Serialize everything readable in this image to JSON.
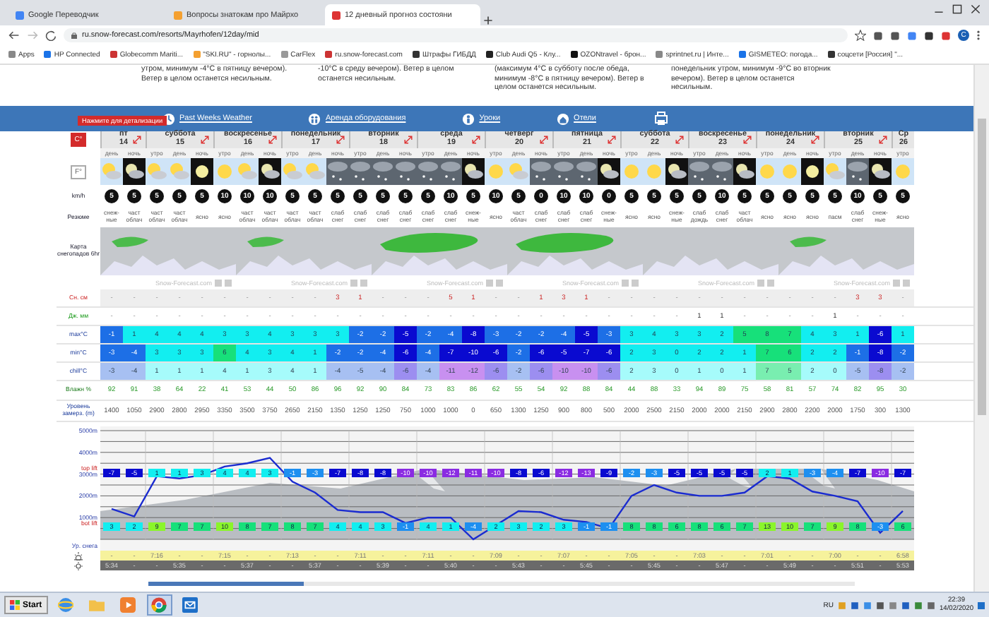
{
  "browser": {
    "tabs": [
      {
        "title": "Google Переводчик",
        "selected": false
      },
      {
        "title": "Вопросы знатокам про Майрхо",
        "selected": false
      },
      {
        "title": "12 дневный прогноз состояни",
        "selected": true
      }
    ],
    "url": "ru.snow-forecast.com/resorts/Mayrhofen/12day/mid",
    "profile": "C",
    "bookmarks": [
      "Apps",
      "HP Connected",
      "Globecomm Mariti...",
      "\"SKI.RU\" - горнолы...",
      "CarFlex",
      "ru.snow-forecast.com",
      "Штрафы ГИБДД",
      "Club Audi Q5 - Клу...",
      "OZONtravel - брон...",
      "sprintnet.ru | Инте...",
      "GISMETEO: погода...",
      "соцсети [Россия] \"..."
    ]
  },
  "summaries": [
    "утром, минимум -4°C в пятницу вечером). Ветер в целом останется несильным.",
    "-10°C в среду вечером). Ветер в целом останется несильным.",
    "(максимум 4°C в субботу после обеда, минимум -8°C в пятницу вечером). Ветер в целом останется несильным.",
    "понедельник утром, минимум -9°C во вторник вечером). Ветер в целом останется несильным."
  ],
  "nav": {
    "badge": "Нажмите для детализации",
    "links": [
      {
        "label": "Past Weeks Weather",
        "kind": "clock"
      },
      {
        "label": "Аренда оборудования",
        "kind": "people"
      },
      {
        "label": "Уроки",
        "kind": "person"
      },
      {
        "label": "Отели",
        "kind": "house"
      }
    ]
  },
  "units": [
    {
      "label": "C°",
      "selected": true
    },
    {
      "label": "F°",
      "selected": false
    }
  ],
  "days": [
    {
      "name": "пт",
      "date": "14",
      "periods": [
        "день",
        "ночь"
      ]
    },
    {
      "name": "суббота",
      "date": "15",
      "periods": [
        "утро",
        "день",
        "ночь"
      ]
    },
    {
      "name": "воскресенье",
      "date": "16",
      "periods": [
        "утро",
        "день",
        "ночь"
      ]
    },
    {
      "name": "понедельник",
      "date": "17",
      "periods": [
        "утро",
        "день",
        "ночь"
      ]
    },
    {
      "name": "вторник",
      "date": "18",
      "periods": [
        "утро",
        "день",
        "ночь"
      ]
    },
    {
      "name": "среда",
      "date": "19",
      "periods": [
        "утро",
        "день",
        "ночь"
      ]
    },
    {
      "name": "четверг",
      "date": "20",
      "periods": [
        "утро",
        "день",
        "ночь"
      ]
    },
    {
      "name": "пятница",
      "date": "21",
      "periods": [
        "утро",
        "день",
        "ночь"
      ]
    },
    {
      "name": "суббота",
      "date": "22",
      "periods": [
        "утро",
        "день",
        "ночь"
      ]
    },
    {
      "name": "воскресенье",
      "date": "23",
      "periods": [
        "утро",
        "день",
        "ночь"
      ]
    },
    {
      "name": "понедельник",
      "date": "24",
      "periods": [
        "утро",
        "день",
        "ночь"
      ]
    },
    {
      "name": "вторник",
      "date": "25",
      "periods": [
        "утро",
        "день",
        "ночь"
      ]
    },
    {
      "name": "Ср",
      "date": "26",
      "periods": [
        "утро"
      ]
    }
  ],
  "labels": {
    "wind": "km/h",
    "summary": "Резюме",
    "map": "Карта снегопадов 6hr"
  },
  "columns": [
    {
      "kind": "partly",
      "wind": "5",
      "summary": "снеж-ные"
    },
    {
      "kind": "night",
      "wind": "5",
      "summary": "част облач"
    },
    {
      "kind": "partly",
      "wind": "5",
      "summary": "част облач"
    },
    {
      "kind": "partly",
      "wind": "5",
      "summary": "част облач"
    },
    {
      "kind": "moon",
      "wind": "5",
      "summary": "ясно"
    },
    {
      "kind": "sun",
      "wind": "10",
      "summary": "ясно"
    },
    {
      "kind": "partly",
      "wind": "10",
      "summary": "част облач"
    },
    {
      "kind": "night",
      "wind": "10",
      "summary": "част облач"
    },
    {
      "kind": "partly",
      "wind": "5",
      "summary": "част облач"
    },
    {
      "kind": "partly",
      "wind": "5",
      "summary": "част облач"
    },
    {
      "kind": "snow",
      "wind": "5",
      "summary": "слаб снег"
    },
    {
      "kind": "snow",
      "wind": "5",
      "summary": "слаб снег"
    },
    {
      "kind": "snow",
      "wind": "5",
      "summary": "слаб снег"
    },
    {
      "kind": "snow",
      "wind": "5",
      "summary": "слаб снег"
    },
    {
      "kind": "snow",
      "wind": "5",
      "summary": "слаб снег"
    },
    {
      "kind": "snow",
      "wind": "10",
      "summary": "слаб снег"
    },
    {
      "kind": "night",
      "wind": "5",
      "summary": "снеж-ные"
    },
    {
      "kind": "sun",
      "wind": "10",
      "summary": "ясно"
    },
    {
      "kind": "partly",
      "wind": "5",
      "summary": "част облач"
    },
    {
      "kind": "snow",
      "wind": "0",
      "summary": "слаб снег"
    },
    {
      "kind": "snow",
      "wind": "10",
      "summary": "слаб снег"
    },
    {
      "kind": "snow",
      "wind": "10",
      "summary": "слаб снег"
    },
    {
      "kind": "night",
      "wind": "0",
      "summary": "снеж-ные"
    },
    {
      "kind": "sun",
      "wind": "5",
      "summary": "ясно"
    },
    {
      "kind": "sun",
      "wind": "5",
      "summary": "ясно"
    },
    {
      "kind": "night",
      "wind": "5",
      "summary": "снеж-ные"
    },
    {
      "kind": "snow",
      "wind": "5",
      "summary": "слаб дождь"
    },
    {
      "kind": "snow",
      "wind": "10",
      "summary": "слаб снег"
    },
    {
      "kind": "night",
      "wind": "5",
      "summary": "част облач"
    },
    {
      "kind": "sun",
      "wind": "5",
      "summary": "ясно"
    },
    {
      "kind": "sun",
      "wind": "5",
      "summary": "ясно"
    },
    {
      "kind": "moon",
      "wind": "5",
      "summary": "ясно"
    },
    {
      "kind": "partly",
      "wind": "5",
      "summary": "пасм"
    },
    {
      "kind": "snow",
      "wind": "10",
      "summary": "слаб снег"
    },
    {
      "kind": "night",
      "wind": "5",
      "summary": "снеж-ные"
    },
    {
      "kind": "sun",
      "wind": "5",
      "summary": "ясно"
    }
  ],
  "maps": [
    {
      "kind": "light",
      "credit": "Snow-Forecast.com"
    },
    {
      "kind": "light",
      "credit": "Snow-Forecast.com"
    },
    {
      "kind": "heavy",
      "credit": "Snow-Forecast.com"
    },
    {
      "kind": "heavy",
      "credit": "Snow-Forecast.com"
    },
    {
      "kind": "none",
      "credit": "Snow-Forecast.com"
    },
    {
      "kind": "light",
      "credit": "Snow-Forecast.com"
    }
  ],
  "rows": [
    {
      "kind": "snow",
      "label": "Сн. см",
      "values": [
        "-",
        "-",
        "-",
        "-",
        "-",
        "-",
        "-",
        "-",
        "-",
        "-",
        "3",
        "1",
        "-",
        "-",
        "-",
        "5",
        "1",
        "-",
        "-",
        "1",
        "3",
        "1",
        "-",
        "-",
        "-",
        "-",
        "-",
        "-",
        "-",
        "-",
        "-",
        "-",
        "-",
        "3",
        "3",
        "-"
      ]
    },
    {
      "kind": "rain",
      "label": "Дж. мм",
      "values": [
        "-",
        "-",
        "-",
        "-",
        "-",
        "-",
        "-",
        "-",
        "-",
        "-",
        "-",
        "-",
        "-",
        "-",
        "-",
        "-",
        "-",
        "-",
        "-",
        "-",
        "-",
        "-",
        "-",
        "-",
        "-",
        "-",
        "1",
        "1",
        "-",
        "-",
        "-",
        "-",
        "1",
        "-",
        "-",
        "-"
      ]
    },
    {
      "kind": "max",
      "label": "max°C",
      "values": [
        "-1",
        "1",
        "4",
        "4",
        "4",
        "3",
        "3",
        "4",
        "3",
        "3",
        "3",
        "-2",
        "-2",
        "-5",
        "-2",
        "-4",
        "-8",
        "-3",
        "-2",
        "-2",
        "-4",
        "-5",
        "-3",
        "3",
        "4",
        "3",
        "3",
        "2",
        "5",
        "8",
        "7",
        "4",
        "3",
        "1",
        "-6",
        "1"
      ]
    },
    {
      "kind": "min",
      "label": "min°C",
      "values": [
        "-3",
        "-4",
        "3",
        "3",
        "3",
        "6",
        "4",
        "3",
        "4",
        "1",
        "-2",
        "-2",
        "-4",
        "-6",
        "-4",
        "-7",
        "-10",
        "-6",
        "-2",
        "-6",
        "-5",
        "-7",
        "-6",
        "2",
        "3",
        "0",
        "2",
        "2",
        "1",
        "7",
        "6",
        "2",
        "2",
        "-1",
        "-8",
        "-2"
      ]
    },
    {
      "kind": "chill",
      "label": "chill°C",
      "values": [
        "-3",
        "-4",
        "1",
        "1",
        "1",
        "4",
        "1",
        "3",
        "4",
        "1",
        "-4",
        "-5",
        "-4",
        "-6",
        "-4",
        "-11",
        "-12",
        "-6",
        "-2",
        "-6",
        "-10",
        "-10",
        "-6",
        "2",
        "3",
        "0",
        "1",
        "0",
        "1",
        "7",
        "5",
        "2",
        "0",
        "-5",
        "-8",
        "-2"
      ]
    },
    {
      "kind": "humidity",
      "label": "Влажн %",
      "values": [
        "92",
        "91",
        "38",
        "64",
        "22",
        "41",
        "53",
        "44",
        "50",
        "86",
        "96",
        "92",
        "90",
        "84",
        "73",
        "83",
        "86",
        "62",
        "55",
        "54",
        "92",
        "88",
        "84",
        "44",
        "88",
        "33",
        "94",
        "89",
        "75",
        "58",
        "81",
        "57",
        "74",
        "82",
        "95",
        "30"
      ]
    },
    {
      "kind": "freeze",
      "label": "Уровень замерз. (m)",
      "values": [
        "1400",
        "1050",
        "2900",
        "2800",
        "2950",
        "3350",
        "3500",
        "3750",
        "2650",
        "2150",
        "1350",
        "1250",
        "1250",
        "750",
        "1000",
        "1000",
        "0",
        "650",
        "1300",
        "1250",
        "900",
        "800",
        "500",
        "2000",
        "2500",
        "2150",
        "2000",
        "2000",
        "2150",
        "2900",
        "2800",
        "2200",
        "2000",
        "1750",
        "300",
        "1300"
      ]
    }
  ],
  "chart": {
    "top_lift": "top lift",
    "bot_lift": "bot lift",
    "snow_level": "Ур. снега",
    "top_temps": [
      "-7",
      "-5",
      "1",
      "1",
      "3",
      "4",
      "4",
      "3",
      "-1",
      "-3",
      "-7",
      "-8",
      "-8",
      "-10",
      "-10",
      "-12",
      "-11",
      "-10",
      "-8",
      "-6",
      "-12",
      "-13",
      "-9",
      "-2",
      "-3",
      "-5",
      "-5",
      "-5",
      "-5",
      "2",
      "1",
      "-3",
      "-4",
      "-7",
      "-10",
      "-7"
    ],
    "bottom_temps": [
      "3",
      "2",
      "9",
      "7",
      "7",
      "10",
      "8",
      "7",
      "8",
      "7",
      "4",
      "4",
      "3",
      "-1",
      "4",
      "1",
      "-4",
      "2",
      "3",
      "2",
      "3",
      "-1",
      "-1",
      "8",
      "8",
      "6",
      "8",
      "6",
      "7",
      "13",
      "10",
      "7",
      "9",
      "8",
      "-3",
      "6"
    ],
    "chart_data": {
      "type": "line",
      "ylim": [
        0,
        5000
      ],
      "grid": true,
      "yticks": [
        {
          "value": 1000,
          "label": "1000m"
        },
        {
          "value": 2000,
          "label": "2000m"
        },
        {
          "value": 3000,
          "label": "3000m"
        },
        {
          "value": 4000,
          "label": "4000m"
        },
        {
          "value": 5000,
          "label": "5000m"
        }
      ],
      "values": [
        1400,
        1050,
        2900,
        2800,
        2950,
        3350,
        3500,
        3750,
        2650,
        2150,
        1350,
        1250,
        1250,
        750,
        1000,
        1000,
        0,
        650,
        1300,
        1250,
        900,
        800,
        500,
        2000,
        2500,
        2150,
        2000,
        2000,
        2150,
        2900,
        2800,
        2200,
        2000,
        1750,
        300,
        1300
      ]
    }
  },
  "sunrise": [
    "-",
    "-",
    "7:16",
    "-",
    "-",
    "7:15",
    "-",
    "-",
    "7:13",
    "-",
    "-",
    "7:11",
    "-",
    "-",
    "7:11",
    "-",
    "-",
    "7:09",
    "-",
    "-",
    "7:07",
    "-",
    "-",
    "7:05",
    "-",
    "-",
    "7:03",
    "-",
    "-",
    "7:01",
    "-",
    "-",
    "7:00",
    "-",
    "-",
    "6:58"
  ],
  "sunset": [
    "5:34",
    "-",
    "-",
    "5:35",
    "-",
    "-",
    "5:37",
    "-",
    "-",
    "5:37",
    "-",
    "-",
    "5:39",
    "-",
    "-",
    "5:40",
    "-",
    "-",
    "5:43",
    "-",
    "-",
    "5:45",
    "-",
    "-",
    "5:45",
    "-",
    "-",
    "5:47",
    "-",
    "-",
    "5:49",
    "-",
    "-",
    "5:51",
    "-",
    "5:53"
  ],
  "taskbar": {
    "start": "Start",
    "language": "RU",
    "time": "22:39",
    "date": "14/02/2020"
  }
}
